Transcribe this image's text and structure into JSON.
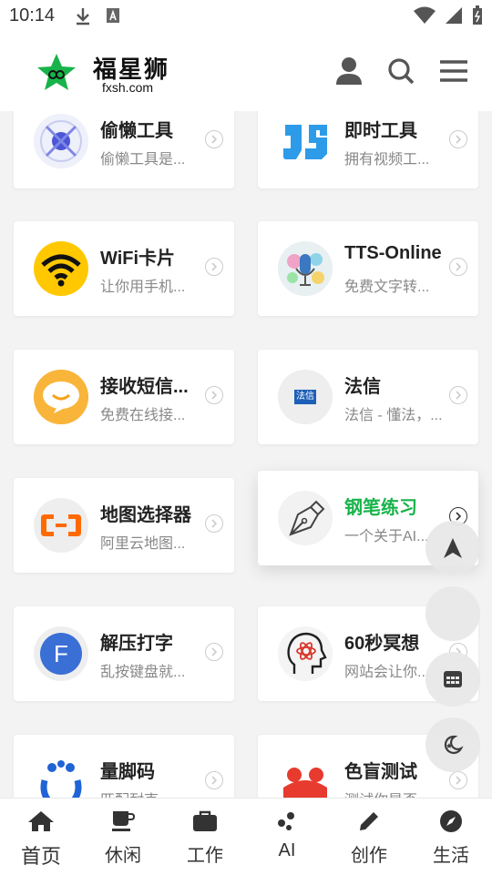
{
  "status_bar": {
    "time": "10:14"
  },
  "header": {
    "brand_title": "福星狮",
    "brand_domain": "fxsh.com"
  },
  "cards": [
    {
      "title": "偷懒工具",
      "desc": "偷懒工具是..."
    },
    {
      "title": "即时工具",
      "desc": "拥有视频工..."
    },
    {
      "title": "WiFi卡片",
      "desc": "让你用手机..."
    },
    {
      "title": "TTS-Online",
      "desc": "免费文字转..."
    },
    {
      "title": "接收短信...",
      "desc": "免费在线接..."
    },
    {
      "title": "法信",
      "desc": "法信 - 懂法，..."
    },
    {
      "title": "地图选择器",
      "desc": "阿里云地图..."
    },
    {
      "title": "钢笔练习",
      "desc": "一个关于AI..."
    },
    {
      "title": "解压打字",
      "desc": "乱按键盘就..."
    },
    {
      "title": "60秒冥想",
      "desc": "网站会让你..."
    },
    {
      "title": "量脚码",
      "desc": "匹配耐克"
    },
    {
      "title": "色盲测试",
      "desc": "测试你是否"
    }
  ],
  "icon_text": {
    "faxin": "法信",
    "f_letter": "F"
  },
  "highlight_color": "#18b34a",
  "tabs": [
    {
      "label": "首页",
      "icon": "home-icon"
    },
    {
      "label": "休闲",
      "icon": "coffee-icon"
    },
    {
      "label": "工作",
      "icon": "briefcase-icon"
    },
    {
      "label": "AI",
      "icon": "ai-icon"
    },
    {
      "label": "创作",
      "icon": "pencil-icon"
    },
    {
      "label": "生活",
      "icon": "compass-icon"
    }
  ]
}
